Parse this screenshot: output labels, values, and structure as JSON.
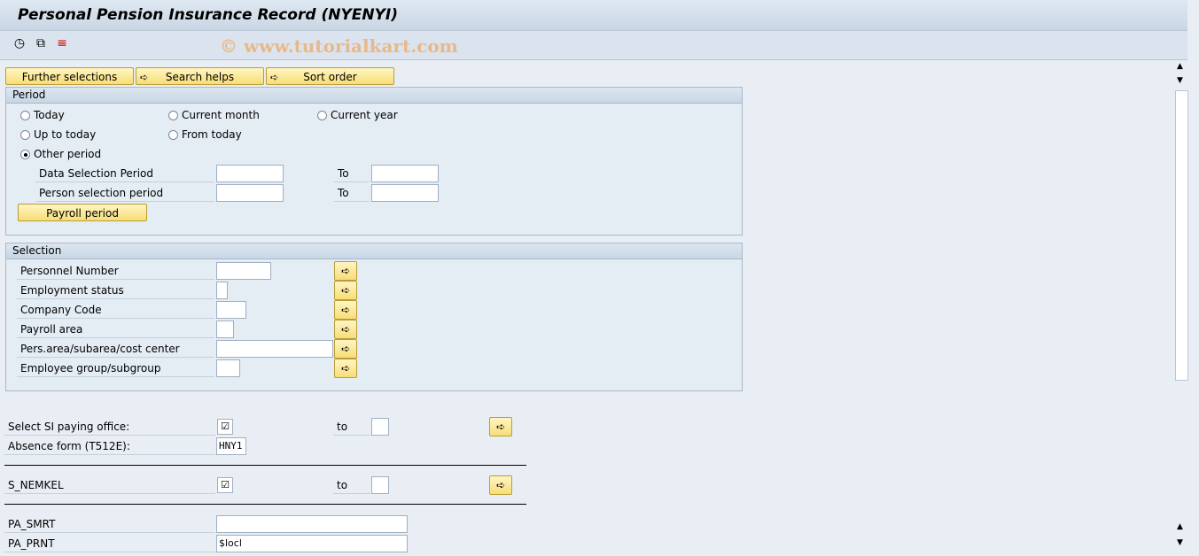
{
  "window": {
    "title": "Personal Pension Insurance Record (NYENYI)",
    "watermark": "© www.tutorialkart.com"
  },
  "toolbar": {
    "icons": [
      "execute-clock-icon",
      "get-variant-icon",
      "selection-options-icon"
    ]
  },
  "buttons": {
    "further_selections": "Further selections",
    "search_helps": "Search helps",
    "sort_order": "Sort order"
  },
  "period": {
    "title": "Period",
    "radios": [
      {
        "label": "Today",
        "selected": false
      },
      {
        "label": "Current month",
        "selected": false
      },
      {
        "label": "Current year",
        "selected": false
      },
      {
        "label": "Up to today",
        "selected": false
      },
      {
        "label": "From today",
        "selected": false
      },
      {
        "label": "Other period",
        "selected": true
      }
    ],
    "data_selection_label": "Data Selection Period",
    "person_selection_label": "Person selection period",
    "to_label": "To",
    "data_from": "",
    "data_to": "",
    "person_from": "",
    "person_to": "",
    "payroll_button": "Payroll period"
  },
  "selection": {
    "title": "Selection",
    "fields": [
      {
        "label": "Personnel Number",
        "value": ""
      },
      {
        "label": "Employment status",
        "value": ""
      },
      {
        "label": "Company Code",
        "value": ""
      },
      {
        "label": "Payroll area",
        "value": ""
      },
      {
        "label": "Pers.area/subarea/cost center",
        "value": ""
      },
      {
        "label": "Employee group/subgroup",
        "value": ""
      }
    ]
  },
  "params": {
    "si_office_label": "Select SI paying office:",
    "si_office_checked": true,
    "to_label": "to",
    "absence_label": "Absence form (T512E):",
    "absence_value": "HNY1",
    "nemkel_label": "S_NEMKEL",
    "nemkel_checked": true,
    "smrt_label": "PA_SMRT",
    "smrt_value": "",
    "prnt_label": "PA_PRNT",
    "prnt_value": "$locl"
  }
}
